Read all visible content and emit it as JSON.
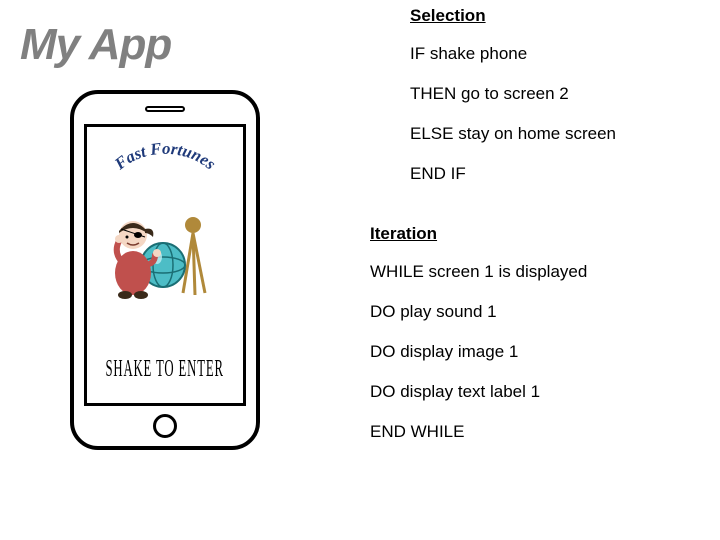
{
  "title": "My App",
  "phone": {
    "arc_text": "Fast Fortunes",
    "shake_text": "SHAKE TO ENTER"
  },
  "selection": {
    "heading": "Selection",
    "lines": {
      "if": "IF shake phone",
      "then": "THEN go to screen 2",
      "else": "ELSE stay on home screen",
      "endif": "END IF"
    }
  },
  "iteration": {
    "heading": "Iteration",
    "lines": {
      "while": "WHILE screen 1 is displayed",
      "do1": "DO play sound 1",
      "do2": "DO display image 1",
      "do3": "DO display text label 1",
      "endwhile": "END WHILE"
    }
  }
}
